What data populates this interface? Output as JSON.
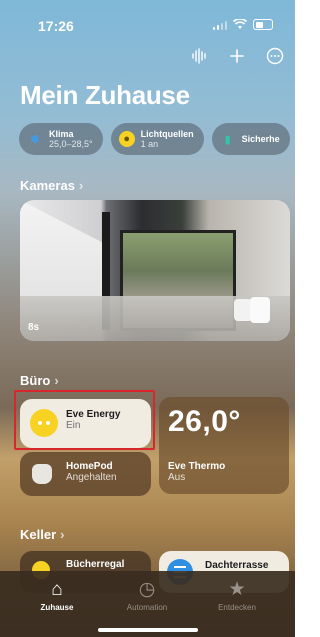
{
  "status": {
    "time": "17:26"
  },
  "toolbar": {
    "voice_icon": "waveform-icon",
    "add_icon": "plus-icon",
    "more_icon": "ellipsis-icon"
  },
  "page": {
    "title": "Mein Zuhause"
  },
  "chips": [
    {
      "label": "Klima",
      "sub": "25,0–28,5°",
      "icon": "fan-icon",
      "icon_color": "#3aa0f5"
    },
    {
      "label": "Lichtquellen",
      "sub": "1 an",
      "icon": "lightbulb-icon",
      "icon_color": "#f8d222"
    },
    {
      "label": "Sicherhe",
      "sub": "",
      "icon": "lock-icon",
      "icon_color": "#34c3a8"
    }
  ],
  "sections": {
    "cameras": "Kameras",
    "office": "Büro",
    "cellar": "Keller"
  },
  "camera": {
    "timestamp": "8s"
  },
  "office": {
    "eve_energy": {
      "name": "Eve Energy",
      "state": "Ein"
    },
    "eve_thermo": {
      "temperature": "26,0°",
      "name": "Eve Thermo",
      "state": "Aus"
    },
    "homepod": {
      "name": "HomePod",
      "state": "Angehalten"
    }
  },
  "cellar": {
    "bookshelf": {
      "name": "Bücherregal"
    },
    "terrace": {
      "name": "Dachterrasse"
    }
  },
  "tabs": [
    {
      "label": "Zuhause",
      "icon": "house-icon",
      "active": true
    },
    {
      "label": "Automation",
      "icon": "clock-icon",
      "active": false
    },
    {
      "label": "Entdecken",
      "icon": "star-icon",
      "active": false
    }
  ],
  "colors": {
    "accent_yellow": "#f8d222",
    "highlight_red": "#d8262c",
    "blind_blue": "#2f8fe3"
  }
}
